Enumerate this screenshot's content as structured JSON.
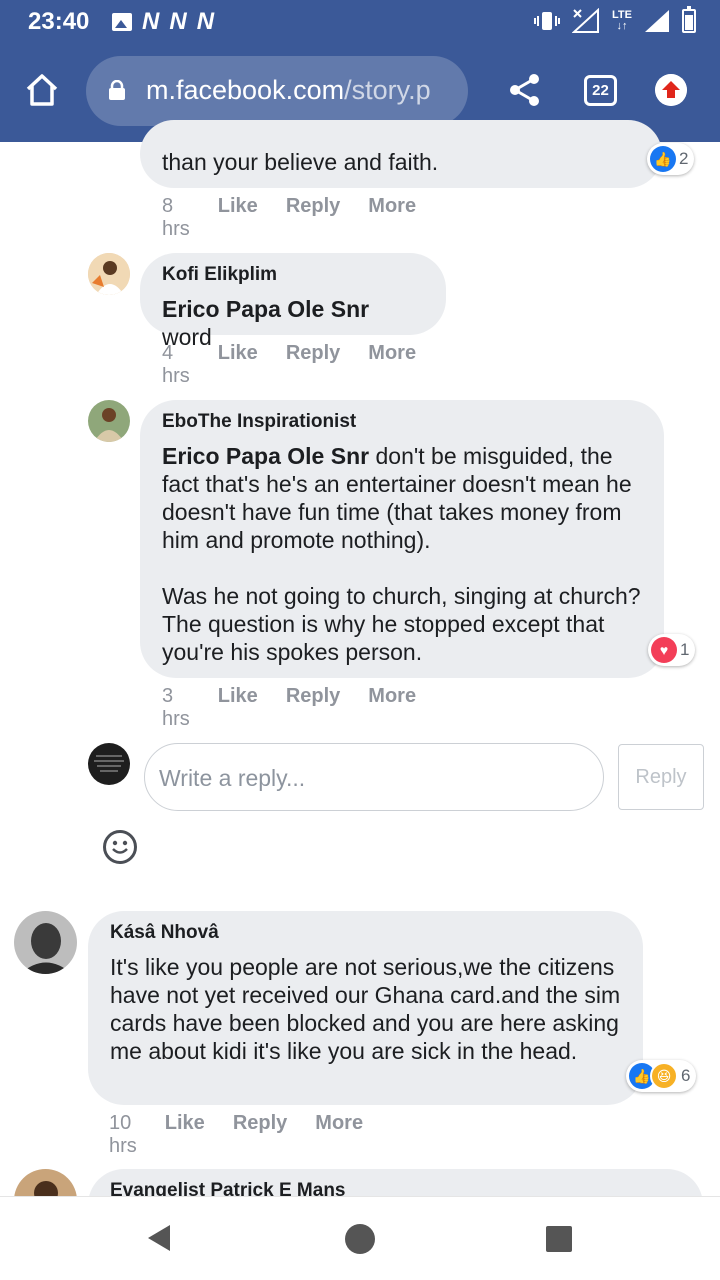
{
  "status_bar": {
    "time": "23:40",
    "notification_icons": [
      "image-icon",
      "n-icon",
      "n-icon",
      "n-icon"
    ],
    "n_glyph": "N",
    "network": "LTE"
  },
  "browser": {
    "url_domain": "m.facebook.com",
    "url_path": "/story.p",
    "tab_count": "22"
  },
  "comments": [
    {
      "author": "",
      "text_lines": [
        "than your believe and faith."
      ],
      "time": "8 hrs",
      "reactions": {
        "types": [
          "like"
        ],
        "count": "2"
      }
    },
    {
      "author": "Kofi Elikplim",
      "mention": "Erico Papa Ole Snr",
      "text": " word",
      "time": "4 hrs"
    },
    {
      "author": "EboThe Inspirationist",
      "mention": "Erico Papa Ole Snr",
      "text_p1": " don't be misguided, the fact that's he's an entertainer doesn't mean he doesn't have fun time (that takes money from him and promote nothing).",
      "text_p2": "Was he not going to church, singing at church? The question is why he stopped except that you're his spokes person.",
      "time": "3 hrs",
      "reactions": {
        "types": [
          "love"
        ],
        "count": "1"
      }
    },
    {
      "author": "Kásâ Nhovâ",
      "text": "It's like you people are not serious,we the citizens have not yet received our Ghana card.and the sim cards have been blocked and you are here asking me about kidi it's like you are sick in the head.",
      "time": "10 hrs",
      "reactions": {
        "types": [
          "like",
          "haha"
        ],
        "count": "6"
      }
    },
    {
      "author": "Evangelist Patrick E Mans"
    }
  ],
  "actions": {
    "like": "Like",
    "reply": "Reply",
    "more": "More"
  },
  "reply_composer": {
    "placeholder": "Write a reply...",
    "button": "Reply"
  }
}
